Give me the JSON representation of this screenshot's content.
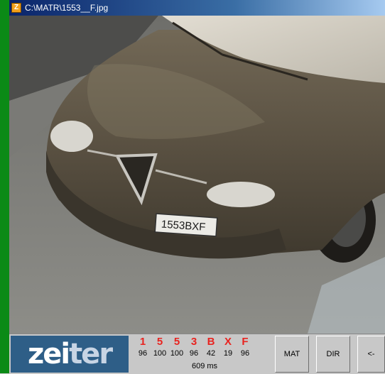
{
  "window": {
    "title": "C:\\MATR\\1553__F.jpg",
    "icon_letter": "Z"
  },
  "logo": {
    "part1": "zei",
    "part2": "ter"
  },
  "plate_text": "1553BXF",
  "ocr": {
    "chars": [
      "1",
      "5",
      "5",
      "3",
      "B",
      "X",
      "F"
    ],
    "confidences": [
      "96",
      "100",
      "100",
      "96",
      "42",
      "19",
      "96"
    ],
    "timing": "609 ms"
  },
  "buttons": {
    "mat": "MAT",
    "dir": "DIR",
    "back": "<-"
  },
  "colors": {
    "ocr_char": "#e8231f",
    "logo_bg": "#2e5e87",
    "side_strip": "#0b8a16"
  }
}
